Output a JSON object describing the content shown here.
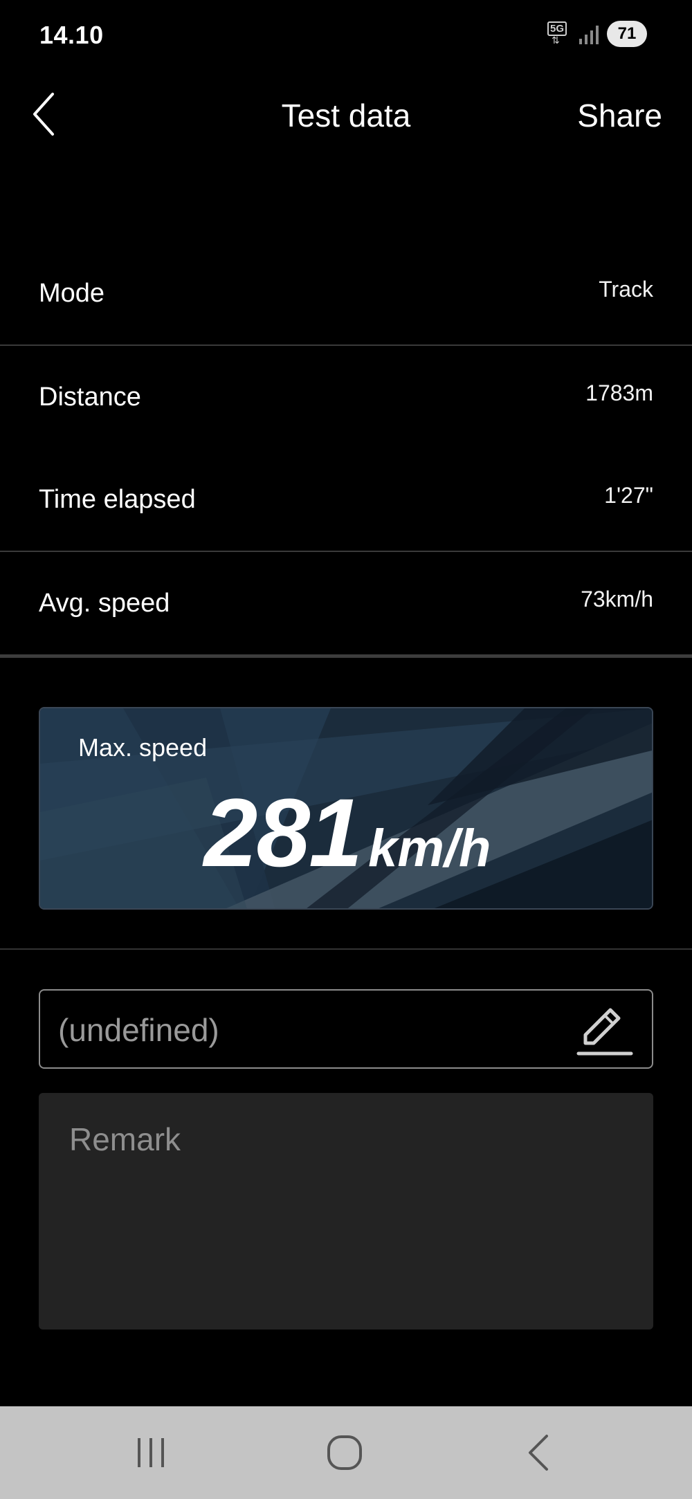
{
  "status_bar": {
    "time": "14.10",
    "network_label": "5G",
    "battery_level": "71"
  },
  "header": {
    "title": "Test data",
    "share_label": "Share"
  },
  "rows": [
    {
      "label": "Mode",
      "value": "Track"
    },
    {
      "label": "Distance",
      "value": "1783m"
    },
    {
      "label": "Time elapsed",
      "value": "1'27\""
    },
    {
      "label": "Avg. speed",
      "value": "73km/h"
    }
  ],
  "max_speed": {
    "label": "Max. speed",
    "value": "281",
    "unit": "km/h"
  },
  "name_field": {
    "value": "(undefined)"
  },
  "remark": {
    "placeholder": "Remark"
  },
  "icons": {
    "back": "chevron-left-icon",
    "edit": "pencil-icon",
    "nav_recents": "recent-apps-icon",
    "nav_home": "home-icon",
    "nav_back": "back-icon"
  },
  "colors": {
    "background": "#000000",
    "card_bg": "#1a2a3a",
    "remark_bg": "#232323",
    "nav_bar_bg": "#c4c4c4"
  }
}
